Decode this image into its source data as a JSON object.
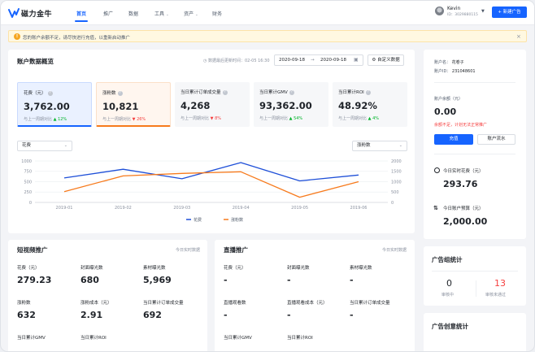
{
  "header": {
    "logo_text": "磁力金牛",
    "nav": [
      "首页",
      "推广",
      "数据",
      "工具",
      "资产",
      "财务"
    ],
    "user": {
      "name": "Kevin",
      "id": "ID：3029880115"
    },
    "new_ad_label": "+ 新建广告"
  },
  "alert": {
    "text": "您的账户余额不足，请尽快进行充值，以重新启动推广",
    "close": "×"
  },
  "overview": {
    "title": "账户数据概览",
    "update_time": "数据最后更新时间：02-05  16:30",
    "date_start": "2020-09-18",
    "date_sep": "→",
    "date_end": "2020-09-18",
    "custom_label": "自定义数据",
    "compare_label": "与上一周期对比",
    "metrics": [
      {
        "label": "花费（元）",
        "value": "3,762.00",
        "change": "12%",
        "dir": "up"
      },
      {
        "label": "涨粉数",
        "value": "10,821",
        "change": "26%",
        "dir": "down"
      },
      {
        "label": "当日累计订单成交量",
        "value": "4,268",
        "change": "8%",
        "dir": "down"
      },
      {
        "label": "当日累计GMV",
        "value": "93,362.00",
        "change": "54%",
        "dir": "up"
      },
      {
        "label": "当日累计ROI",
        "value": "48.92%",
        "change": "4%",
        "dir": "up"
      }
    ],
    "left_select": "花费",
    "right_select": "涨粉数"
  },
  "chart_data": {
    "type": "line",
    "x": [
      "2019-01",
      "2019-02",
      "2019-03",
      "2019-04",
      "2019-05",
      "2019-06"
    ],
    "y_left_ticks": [
      "1000",
      "750",
      "500",
      "250",
      "0"
    ],
    "y_right_ticks": [
      "2000",
      "1500",
      "1000",
      "500",
      "0"
    ],
    "ylim_left": [
      0,
      1000
    ],
    "ylim_right": [
      0,
      2000
    ],
    "series": [
      {
        "name": "花费",
        "axis": "left",
        "color": "#1e4fd8",
        "values": [
          590,
          800,
          570,
          960,
          520,
          660
        ]
      },
      {
        "name": "涨粉数",
        "axis": "right",
        "color": "#f77a1c",
        "values": [
          520,
          1280,
          1400,
          1480,
          250,
          1000
        ]
      }
    ]
  },
  "short_video": {
    "title": "短视频推广",
    "realtime": "今日实时数据",
    "stats": [
      {
        "label": "花费（元）",
        "value": "279.23"
      },
      {
        "label": "封面曝光数",
        "value": "680"
      },
      {
        "label": "素材曝光数",
        "value": "5,969"
      },
      {
        "label": "涨粉数",
        "value": "632"
      },
      {
        "label": "涨粉成本（元）",
        "value": "2.91"
      },
      {
        "label": "当日累计订单成交量",
        "value": "692"
      },
      {
        "label": "当日累计GMV",
        "value": ""
      },
      {
        "label": "当日累计ROI",
        "value": ""
      }
    ]
  },
  "live": {
    "title": "直播推广",
    "realtime": "今日实时数据",
    "stats": [
      {
        "label": "花费（元）",
        "value": "-"
      },
      {
        "label": "封面曝光数",
        "value": "-"
      },
      {
        "label": "素材曝光数",
        "value": "-"
      },
      {
        "label": "直播观看数",
        "value": "-"
      },
      {
        "label": "直播观看成本（元）",
        "value": "-"
      },
      {
        "label": "当日累计订单成交量",
        "value": "-"
      },
      {
        "label": "当日累计GMV",
        "value": ""
      },
      {
        "label": "当日累计ROI",
        "value": ""
      }
    ]
  },
  "account": {
    "name_label": "账户名：",
    "name": "花卷子",
    "id_label": "账户ID：",
    "id": "231048601",
    "balance_label": "账户余额（元）",
    "balance": "0.00",
    "warning": "余额不足，计划无法正常推广",
    "recharge": "充值",
    "flow": "账户流水",
    "today_spend_label": "今日实时花费（元）",
    "today_spend": "293.76",
    "today_budget_label": "今日账户预算（元）",
    "today_budget": "2,000.00"
  },
  "ad_group": {
    "title": "广告组统计",
    "reviewing_value": "0",
    "reviewing_label": "审核中",
    "rejected_value": "13",
    "rejected_label": "审核未通过"
  },
  "creative": {
    "title": "广告创意统计"
  },
  "colors": {
    "accent": "#1664ff",
    "up": "#00b42a",
    "down": "#f53f3f",
    "warning": "#f53f3f"
  }
}
